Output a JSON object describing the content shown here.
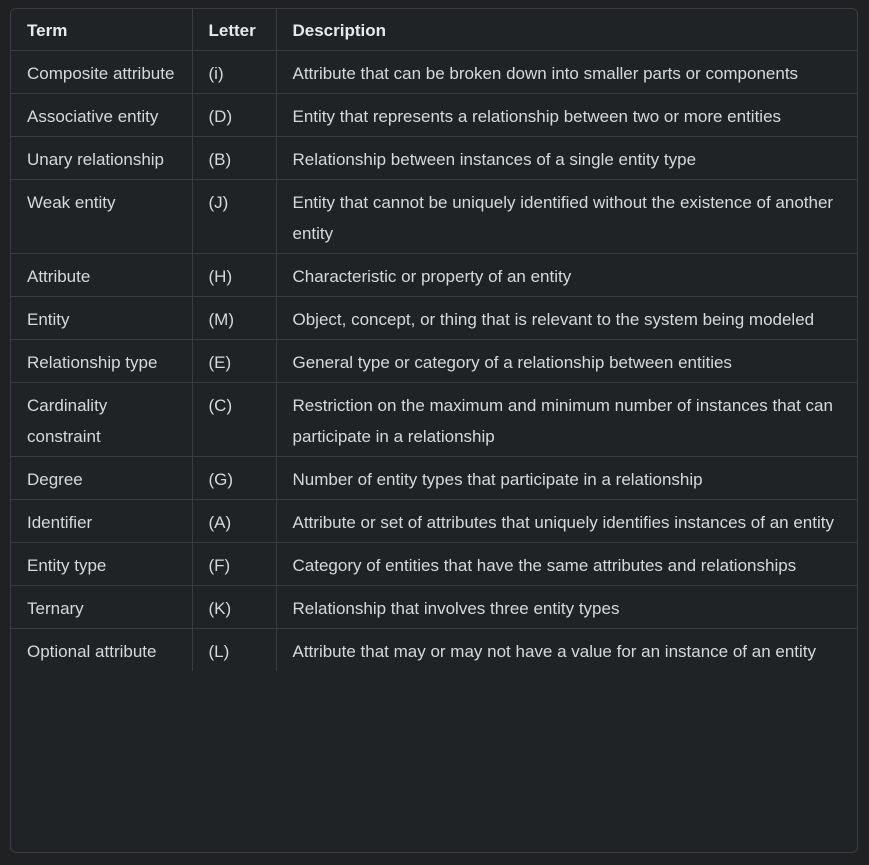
{
  "table": {
    "headers": [
      "Term",
      "Letter",
      "Description"
    ],
    "rows": [
      {
        "term": "Composite attribute",
        "letter": "(i)",
        "description": "Attribute that can be broken down into smaller parts or components"
      },
      {
        "term": "Associative entity",
        "letter": "(D)",
        "description": "Entity that represents a relationship between two or more entities"
      },
      {
        "term": "Unary relationship",
        "letter": "(B)",
        "description": "Relationship between instances of a single entity type"
      },
      {
        "term": "Weak entity",
        "letter": "(J)",
        "description": "Entity that cannot be uniquely identified without the existence of another entity"
      },
      {
        "term": "Attribute",
        "letter": "(H)",
        "description": "Characteristic or property of an entity"
      },
      {
        "term": "Entity",
        "letter": "(M)",
        "description": "Object, concept, or thing that is relevant to the system being modeled"
      },
      {
        "term": "Relationship type",
        "letter": "(E)",
        "description": "General type or category of a relationship between entities"
      },
      {
        "term": "Cardinality constraint",
        "letter": "(C)",
        "description": "Restriction on the maximum and minimum number of instances that can participate in a relationship"
      },
      {
        "term": "Degree",
        "letter": "(G)",
        "description": "Number of entity types that participate in a relationship"
      },
      {
        "term": "Identifier",
        "letter": "(A)",
        "description": "Attribute or set of attributes that uniquely identifies instances of an entity"
      },
      {
        "term": "Entity type",
        "letter": "(F)",
        "description": "Category of entities that have the same attributes and relationships"
      },
      {
        "term": "Ternary",
        "letter": "(K)",
        "description": "Relationship that involves three entity types"
      },
      {
        "term": "Optional attribute",
        "letter": "(L)",
        "description": "Attribute that may or may not have a value for an instance of an entity"
      }
    ]
  }
}
